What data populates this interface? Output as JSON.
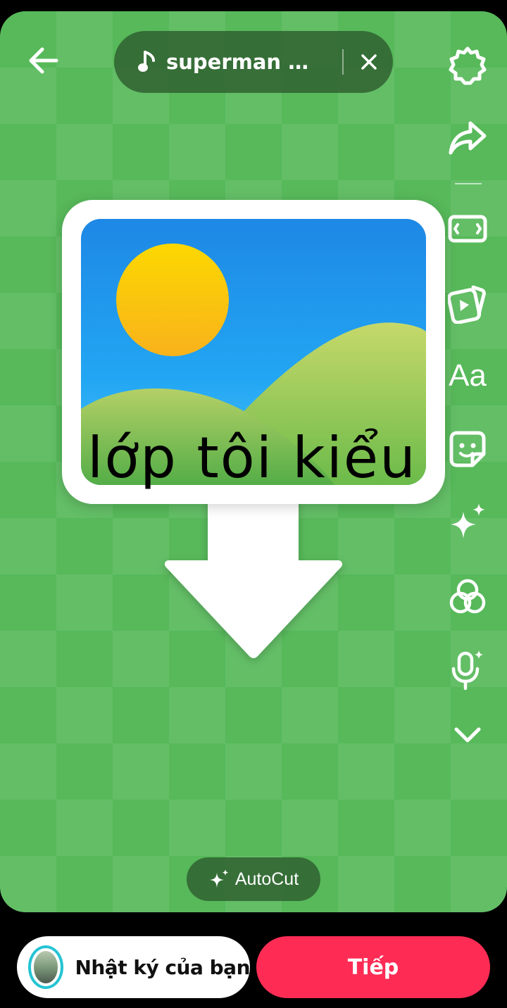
{
  "music": {
    "title": "superman 🤖 -...",
    "icon": "music-note-icon"
  },
  "toolbar": {
    "back_icon": "arrow-left-icon",
    "close_icon": "close-icon",
    "rail": [
      {
        "name": "settings",
        "icon": "gear-icon"
      },
      {
        "name": "share",
        "icon": "share-arrow-icon"
      },
      {
        "name": "aspect-ratio",
        "icon": "aspect-ratio-icon"
      },
      {
        "name": "templates",
        "icon": "video-template-icon"
      },
      {
        "name": "text",
        "icon": "text-icon",
        "label": "Aa"
      },
      {
        "name": "stickers",
        "icon": "sticker-icon"
      },
      {
        "name": "effects",
        "icon": "sparkle-icon"
      },
      {
        "name": "filters",
        "icon": "filters-icon"
      },
      {
        "name": "voice",
        "icon": "microphone-icon"
      },
      {
        "name": "more",
        "icon": "chevron-down-icon"
      }
    ]
  },
  "canvas": {
    "caption": "lớp tôi kiểu",
    "background_color": "#57b95a"
  },
  "autocut": {
    "label": "AutoCut"
  },
  "bottom": {
    "journal_label": "Nhật ký của bạn",
    "next_label": "Tiếp",
    "next_color": "#fe2c55"
  }
}
